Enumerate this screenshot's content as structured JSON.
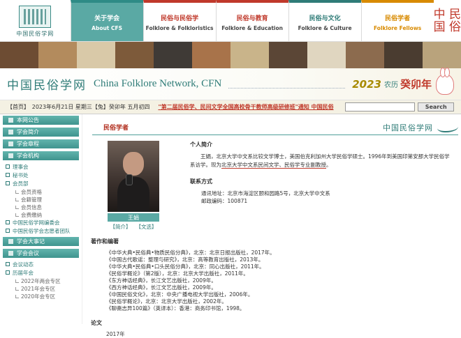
{
  "nav": {
    "logo_text": "中国民俗学网",
    "items": [
      {
        "zh": "关于学会",
        "en": "About CFS"
      },
      {
        "zh": "民俗与民俗学",
        "en": "Folklore & Folkloristics"
      },
      {
        "zh": "民俗与教育",
        "en": "Folklore & Education"
      },
      {
        "zh": "民俗与文化",
        "en": "Folklore & Culture"
      },
      {
        "zh": "民俗学者",
        "en": "Folklore Fellows"
      }
    ],
    "corner_logo": "中 民\n国 俗"
  },
  "header": {
    "site_cn": "中国民俗学网",
    "site_en": "China Folklore Network, CFN",
    "year": "2023",
    "lunar_a": "农历",
    "lunar_b": "癸卯年"
  },
  "infobar": {
    "home": "【首页】",
    "date": "2023年6月21日 星期三【兔】癸卯年 五月初四",
    "marquee": "\"第二届民俗学、民间文学全国高校骨干教师高级研修班\"通知   中国民俗",
    "search_label": "Search"
  },
  "colors": {
    "teal": "#5aa9a4",
    "red": "#c0392b",
    "gold": "#a78a00"
  },
  "sidebar": {
    "heads": [
      "本网公告",
      "学会简介",
      "学会章程",
      "学会机构"
    ],
    "org_items": [
      {
        "type": "sub",
        "label": "理事会"
      },
      {
        "type": "sub",
        "label": "秘书处"
      },
      {
        "type": "sub",
        "label": "会员部"
      },
      {
        "type": "leaf",
        "label": "会员资格"
      },
      {
        "type": "leaf",
        "label": "会籍管理"
      },
      {
        "type": "leaf",
        "label": "会员信息"
      },
      {
        "type": "leaf",
        "label": "会费缴纳"
      },
      {
        "type": "sub",
        "label": "中国民俗学网编委会"
      },
      {
        "type": "sub",
        "label": "中国民俗学会志愿者团队"
      }
    ],
    "heads2": [
      "学会大事记",
      "学会会议"
    ],
    "meeting_items": [
      {
        "type": "sub",
        "label": "会议动态"
      },
      {
        "type": "sub",
        "label": "历届年会"
      },
      {
        "type": "leaf",
        "label": "2022年两会专区"
      },
      {
        "type": "leaf",
        "label": "2021年会专区"
      },
      {
        "type": "leaf",
        "label": "2020年会专区"
      }
    ]
  },
  "main": {
    "section_title": "民俗学者",
    "section_logo": "中国民俗学网",
    "person": {
      "name": "王娟",
      "link_intro": "【简介】",
      "link_articles": "【文选】"
    },
    "bio_title": "个人简介",
    "bio_a": "王娟，北京大学中文系比较文学博士，美国伯克利加州大学民俗学硕士。1996年到美国印第安那大学民俗学系访学。现为",
    "bio_b": "北京大学中文系民间文学、民俗学专业副教授",
    "bio_c": "。",
    "contact_title": "联系方式",
    "contact_address": "通讯地址：北京市海淀区颐和园路5号，北京大学中文系",
    "contact_postcode": "邮政编码：100871",
    "works_title": "著作和编著",
    "works": [
      "《中华大典•民俗典•物质民俗分典》，北京：北京日报出版社，2017年。",
      "《中国古代歌谣：整理与研究》，北京：高等教育出版社，2013年。",
      "《中华大典•民俗典•口头民俗分典》，北京：同心出版社，2011年。",
      "《民俗学概论》（第2版），北京：北京大学出版社，2011年。",
      "《东方神话经典》，长江文艺出版社，2009年。",
      "《西方神话经典》，长江文艺出版社，2009年。",
      "《中国民俗文化》，北京：中央广播电视大学出版社，2006年。",
      "《民俗学概论》，北京：北京大学出版社，2002年。",
      "《聊斋志异100篇》（英译本）：香港：商务印书馆，1998。"
    ],
    "papers_title": "论文",
    "paper_year": "2017年"
  }
}
